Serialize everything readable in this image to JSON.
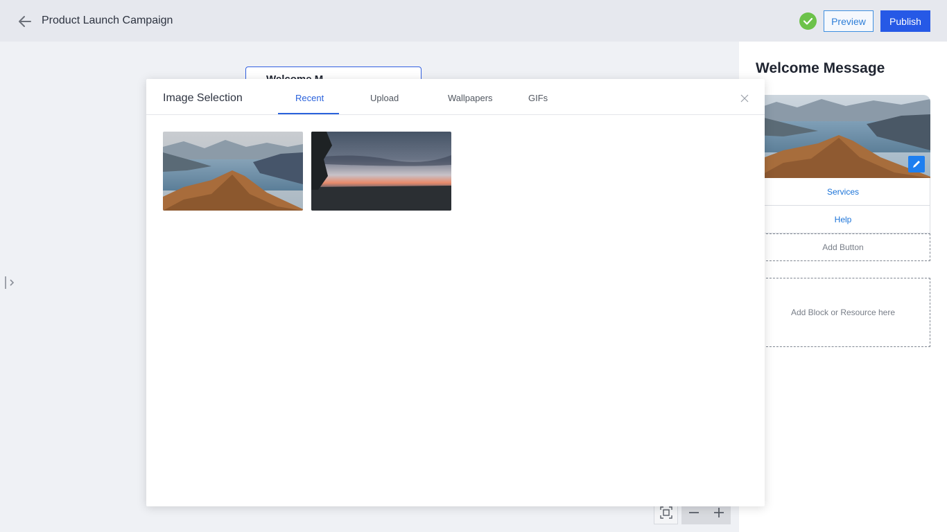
{
  "header": {
    "title": "Product Launch Campaign",
    "preview_label": "Preview",
    "publish_label": "Publish"
  },
  "canvas": {
    "node_title": "Welcome M..."
  },
  "modal": {
    "title": "Image Selection",
    "tabs": [
      {
        "label": "Recent",
        "active": true
      },
      {
        "label": "Upload",
        "active": false
      },
      {
        "label": "Wallpapers",
        "active": false
      },
      {
        "label": "GIFs",
        "active": false
      }
    ],
    "images": [
      {
        "name": "mountain-lake-image"
      },
      {
        "name": "sunset-landscape-image"
      }
    ]
  },
  "panel": {
    "title": "Welcome Message",
    "buttons": [
      "Services",
      "Help"
    ],
    "add_button_label": "Add Button",
    "add_block_label": "Add Block or Resource here"
  },
  "colors": {
    "accent": "#2659e6",
    "link": "#1a73d8",
    "success": "#6cc24a"
  }
}
